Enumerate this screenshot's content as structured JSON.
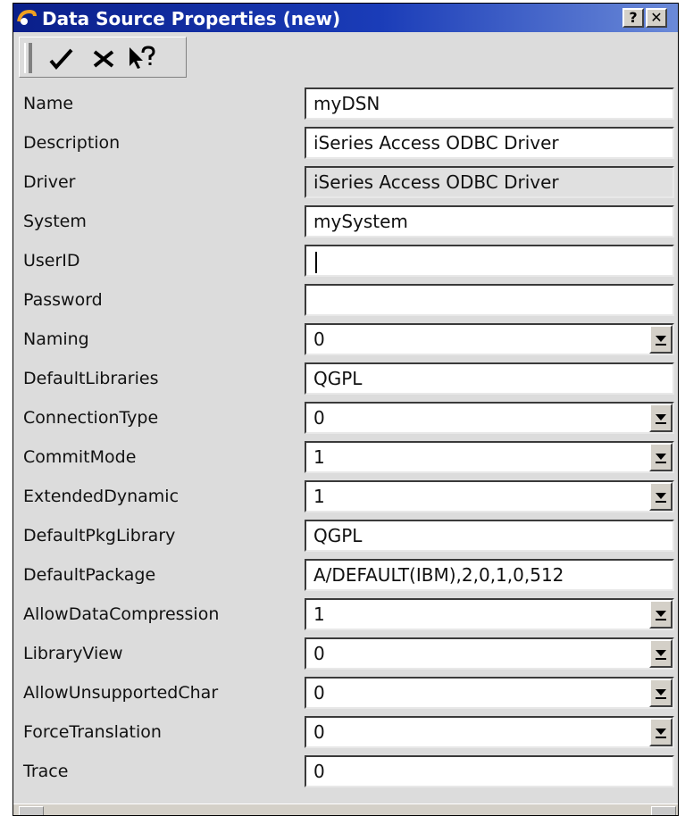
{
  "window": {
    "title": "Data Source Properties (new)",
    "help_button": "?",
    "close_button": "✕"
  },
  "toolbar": {
    "icons": [
      "checkmark-icon",
      "cancel-x-icon",
      "context-help-icon"
    ]
  },
  "fields": [
    {
      "label": "Name",
      "value": "myDSN",
      "type": "text"
    },
    {
      "label": "Description",
      "value": "iSeries Access ODBC Driver",
      "type": "text"
    },
    {
      "label": "Driver",
      "value": "iSeries Access ODBC Driver",
      "type": "readonly"
    },
    {
      "label": "System",
      "value": "mySystem",
      "type": "text"
    },
    {
      "label": "UserID",
      "value": "",
      "type": "text"
    },
    {
      "label": "Password",
      "value": "",
      "type": "password"
    },
    {
      "label": "Naming",
      "value": "0",
      "type": "select"
    },
    {
      "label": "DefaultLibraries",
      "value": "QGPL",
      "type": "text"
    },
    {
      "label": "ConnectionType",
      "value": "0",
      "type": "select"
    },
    {
      "label": "CommitMode",
      "value": "1",
      "type": "select"
    },
    {
      "label": "ExtendedDynamic",
      "value": "1",
      "type": "select"
    },
    {
      "label": "DefaultPkgLibrary",
      "value": "QGPL",
      "type": "text"
    },
    {
      "label": "DefaultPackage",
      "value": "A/DEFAULT(IBM),2,0,1,0,512",
      "type": "text"
    },
    {
      "label": "AllowDataCompression",
      "value": "1",
      "type": "select"
    },
    {
      "label": "LibraryView",
      "value": "0",
      "type": "select"
    },
    {
      "label": "AllowUnsupportedChar",
      "value": "0",
      "type": "select"
    },
    {
      "label": "ForceTranslation",
      "value": "0",
      "type": "select"
    },
    {
      "label": "Trace",
      "value": "0",
      "type": "text"
    }
  ],
  "colors": {
    "titlebar_start": "#0a1f8a",
    "titlebar_end": "#6b8ad8",
    "window_bg": "#dcdcdc",
    "field_bg": "#ffffff"
  }
}
